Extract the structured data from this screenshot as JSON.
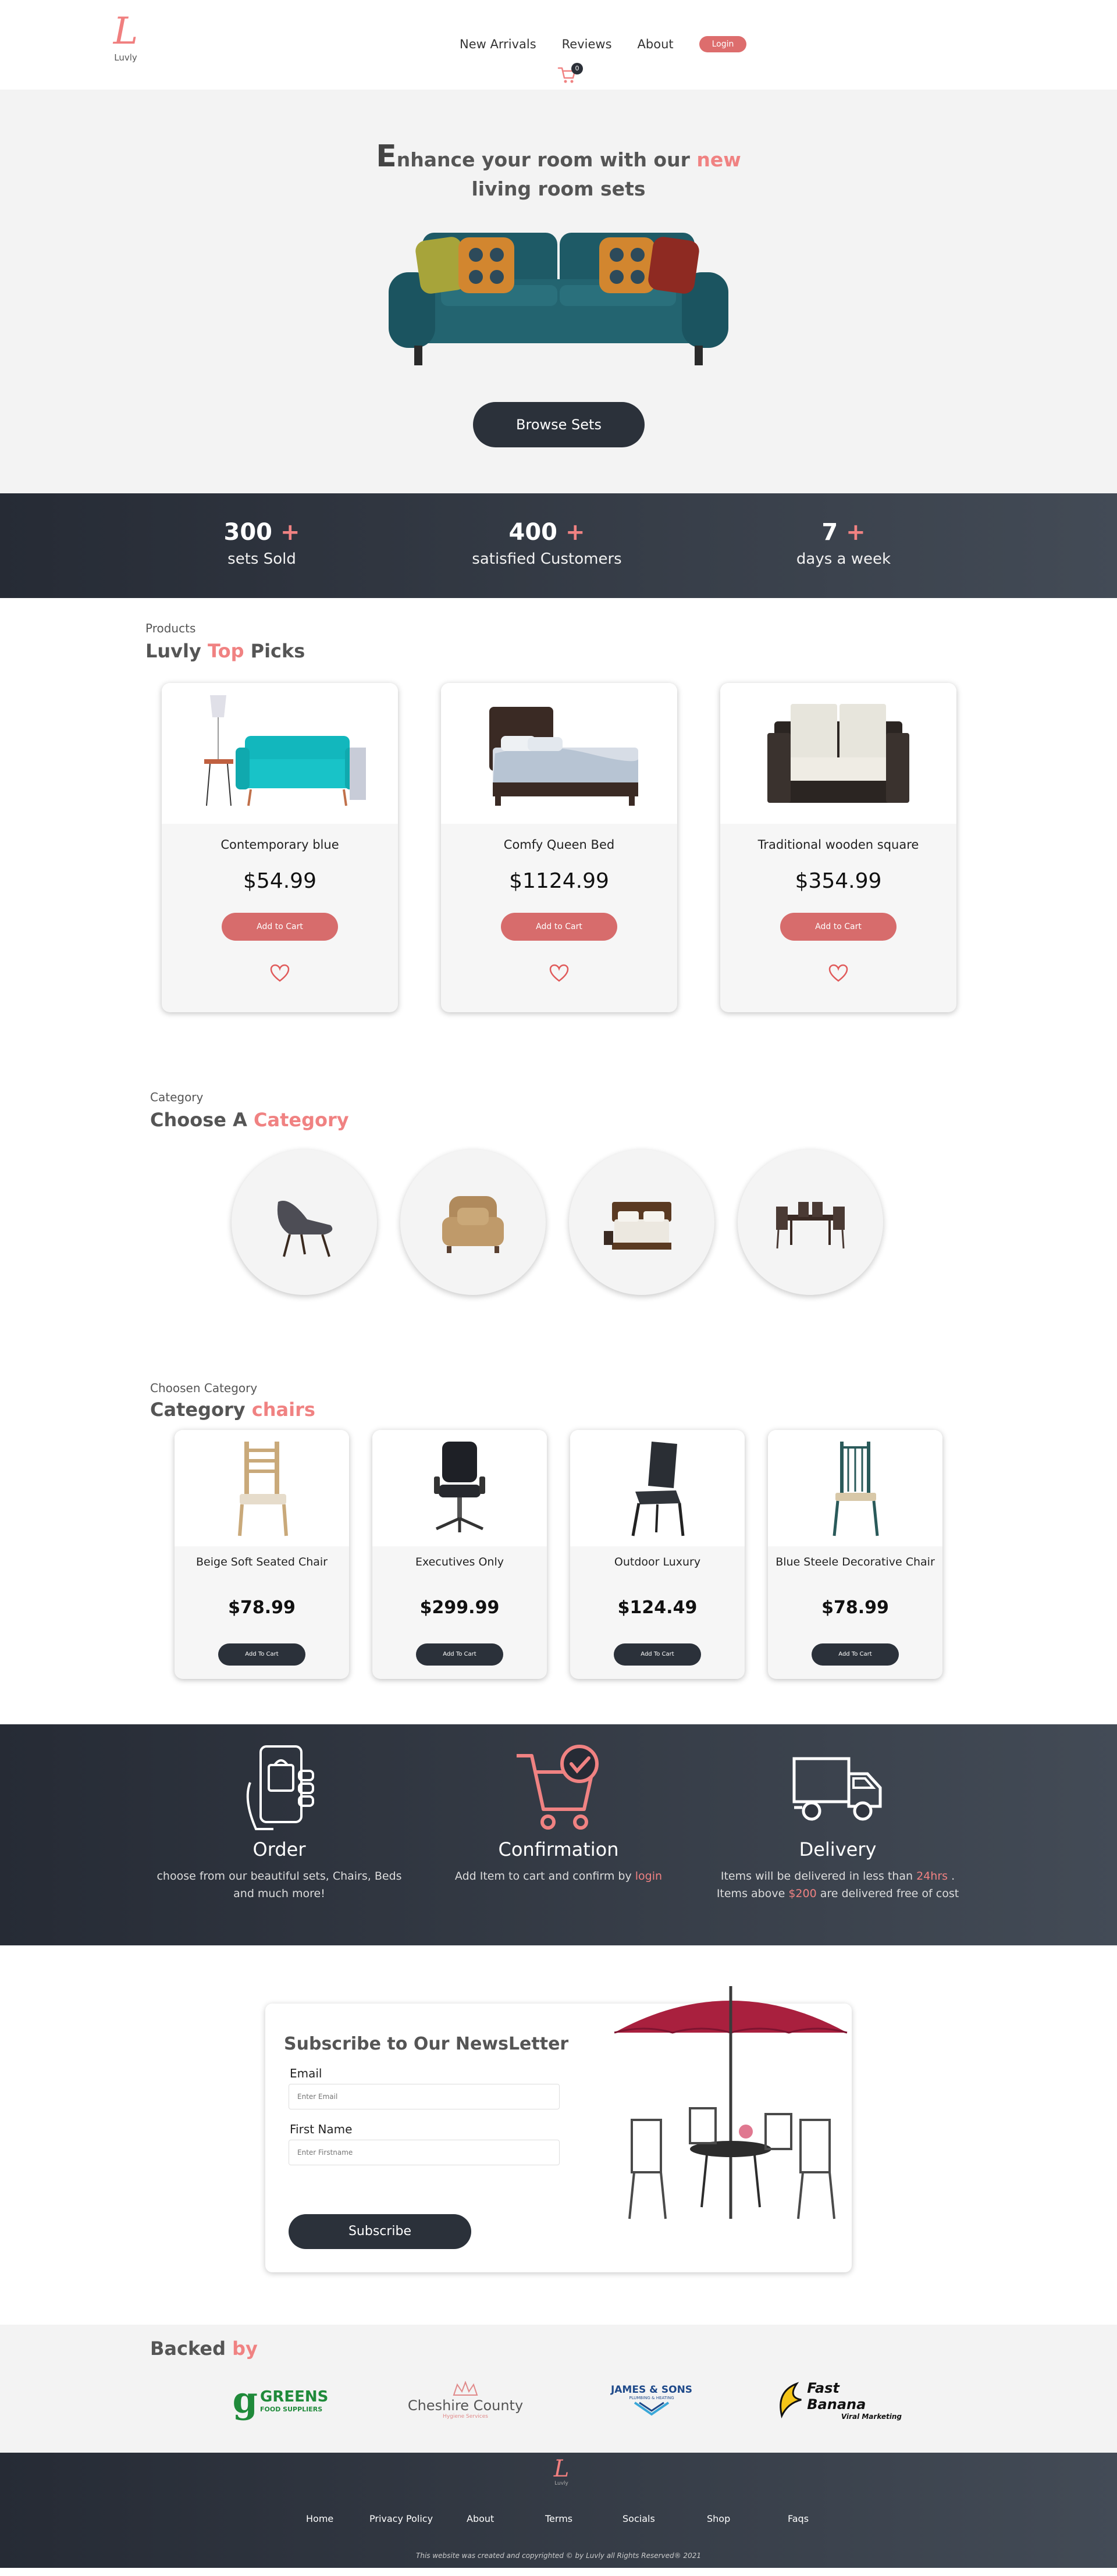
{
  "brand": {
    "logo_letter": "L",
    "name": "Luvly",
    "accent": "#f08282",
    "dark": "#2b313a"
  },
  "nav": {
    "links": [
      "New Arrivals",
      "Reviews",
      "About"
    ],
    "login_label": "Login",
    "cart_count": "0"
  },
  "hero": {
    "title_first": "E",
    "title_rest": "nhance your room with our",
    "title_highlight": "new",
    "title_line2": "living room sets",
    "button_label": "Browse Sets"
  },
  "stats": [
    {
      "number": "300",
      "plus": "+",
      "label": "sets Sold"
    },
    {
      "number": "400",
      "plus": "+",
      "label": "satisfied Customers"
    },
    {
      "number": "7",
      "plus": "+",
      "label": "days a week"
    }
  ],
  "top_picks": {
    "label": "Products",
    "title_start": "Luvly",
    "title_highlight": "Top",
    "title_end": "Picks",
    "products": [
      {
        "name": "Contemporary blue",
        "price": "$54.99",
        "button": "Add to Cart",
        "image": "teal-sofa"
      },
      {
        "name": "Comfy Queen Bed",
        "price": "$1124.99",
        "button": "Add to Cart",
        "image": "queen-bed"
      },
      {
        "name": "Traditional wooden square",
        "price": "$354.99",
        "button": "Add to Cart",
        "image": "loveseat"
      }
    ]
  },
  "category": {
    "label": "Category",
    "title_start": "Choose A",
    "title_highlight": "Category",
    "items": [
      "lounge-chair",
      "armchair",
      "bed",
      "dining-set"
    ]
  },
  "chosen": {
    "label": "Choosen Category",
    "title_start": "Category",
    "title_highlight": "chairs",
    "products": [
      {
        "name": "Beige Soft Seated Chair",
        "price": "$78.99",
        "button": "Add To Cart"
      },
      {
        "name": "Executives Only",
        "price": "$299.99",
        "button": "Add To Cart"
      },
      {
        "name": "Outdoor Luxury",
        "price": "$124.49",
        "button": "Add To Cart"
      },
      {
        "name": "Blue Steele Decorative Chair",
        "price": "$78.99",
        "button": "Add To Cart"
      }
    ]
  },
  "steps": [
    {
      "title": "Order",
      "text": "choose from our beautiful sets, Chairs, Beds and much more!",
      "icon": "phone-bag-icon"
    },
    {
      "title": "Confirmation",
      "text_before": "Add Item to cart and confirm by",
      "text_highlight": "login",
      "icon": "cart-check-icon"
    },
    {
      "title": "Delivery",
      "text_a": "Items will be delivered in less than",
      "text_b": "24hrs",
      "text_c": ". Items above",
      "text_d": "$200",
      "text_e": "are delivered free of cost",
      "icon": "truck-icon"
    }
  ],
  "newsletter": {
    "title": "Subscribe to Our NewsLetter",
    "email_label": "Email",
    "email_placeholder": "Enter Email",
    "name_label": "First Name",
    "name_placeholder": "Enter Firstname",
    "button": "Subscribe"
  },
  "backed": {
    "title_start": "Backed",
    "title_highlight": "by",
    "sponsors": [
      {
        "big_letter": "g",
        "line1": "GREENS",
        "line2": "FOOD SUPPLIERS"
      },
      {
        "line1": "Cheshire County",
        "line2": "Hygiene Services"
      },
      {
        "line1": "JAMES & SONS",
        "line2": "PLUMBING & HEATING"
      },
      {
        "line1": "Fast Banana",
        "line2": "Viral Marketing"
      }
    ]
  },
  "footer": {
    "links": [
      "Home",
      "Privacy Policy",
      "About",
      "Terms",
      "Socials",
      "Shop",
      "Faqs"
    ],
    "copyright": "This website was created and copyrighted © by Luvly all Rights Reserved® 2021"
  }
}
